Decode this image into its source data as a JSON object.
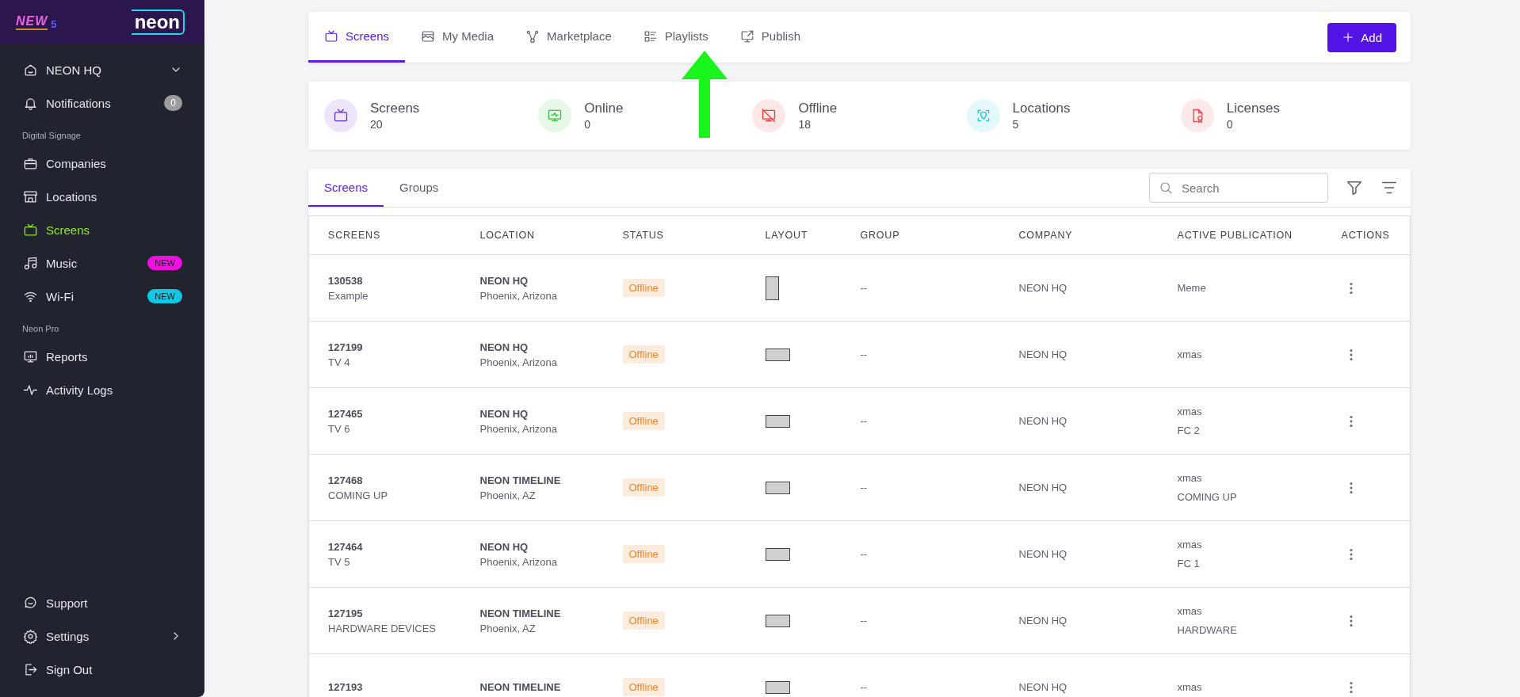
{
  "sidebar": {
    "banner": {
      "text": "NEW",
      "number": "5"
    },
    "logo": "neon",
    "account": {
      "label": "NEON HQ"
    },
    "notifications": {
      "label": "Notifications",
      "count": "0"
    },
    "sections": [
      {
        "title": "Digital Signage",
        "items": [
          {
            "label": "Companies",
            "selected": false
          },
          {
            "label": "Locations",
            "selected": false
          },
          {
            "label": "Screens",
            "selected": true
          },
          {
            "label": "Music",
            "selected": false,
            "badge": {
              "text": "NEW",
              "color": "#f20fe2"
            }
          },
          {
            "label": "Wi-Fi",
            "selected": false,
            "badge": {
              "text": "NEW",
              "color": "#10c8e6"
            }
          }
        ]
      },
      {
        "title": "Neon Pro",
        "items": [
          {
            "label": "Reports",
            "selected": false
          },
          {
            "label": "Activity Logs",
            "selected": false
          }
        ]
      }
    ],
    "footer": [
      {
        "label": "Support",
        "kind": "link"
      },
      {
        "label": "Settings",
        "kind": "submenu"
      },
      {
        "label": "Sign Out",
        "kind": "link"
      }
    ]
  },
  "top_tabs": [
    {
      "label": "Screens",
      "selected": true
    },
    {
      "label": "My Media",
      "selected": false
    },
    {
      "label": "Marketplace",
      "selected": false
    },
    {
      "label": "Playlists",
      "selected": false
    },
    {
      "label": "Publish",
      "selected": false
    }
  ],
  "add_button": "Add",
  "stats": [
    {
      "label": "Screens",
      "value": "20",
      "color": "#6b2fe0"
    },
    {
      "label": "Online",
      "value": "0",
      "color": "#33c13f"
    },
    {
      "label": "Offline",
      "value": "18",
      "color": "#ee3a3a"
    },
    {
      "label": "Locations",
      "value": "5",
      "color": "#1ec5db"
    },
    {
      "label": "Licenses",
      "value": "0",
      "color": "#e6494a"
    }
  ],
  "list_tabs": [
    {
      "label": "Screens",
      "selected": true
    },
    {
      "label": "Groups",
      "selected": false
    }
  ],
  "search": {
    "placeholder": "Search"
  },
  "table": {
    "columns": [
      "SCREENS",
      "LOCATION",
      "STATUS",
      "LAYOUT",
      "GROUP",
      "COMPANY",
      "ACTIVE PUBLICATION",
      "ACTIONS"
    ],
    "rows": [
      {
        "id": "130538",
        "name": "Example",
        "location": "NEON HQ",
        "city": "Phoenix, Arizona",
        "status": "Offline",
        "layout_portrait": true,
        "group": "--",
        "company": "NEON HQ",
        "publication": [
          "Meme"
        ]
      },
      {
        "id": "127199",
        "name": "TV 4",
        "location": "NEON HQ",
        "city": "Phoenix, Arizona",
        "status": "Offline",
        "layout_portrait": false,
        "group": "--",
        "company": "NEON HQ",
        "publication": [
          "xmas"
        ]
      },
      {
        "id": "127465",
        "name": "TV 6",
        "location": "NEON HQ",
        "city": "Phoenix, Arizona",
        "status": "Offline",
        "layout_portrait": false,
        "group": "--",
        "company": "NEON HQ",
        "publication": [
          "xmas",
          "FC 2"
        ]
      },
      {
        "id": "127468",
        "name": "COMING UP",
        "location": "NEON TIMELINE",
        "city": "Phoenix, AZ",
        "status": "Offline",
        "layout_portrait": false,
        "group": "--",
        "company": "NEON HQ",
        "publication": [
          "xmas",
          "COMING UP"
        ]
      },
      {
        "id": "127464",
        "name": "TV 5",
        "location": "NEON HQ",
        "city": "Phoenix, Arizona",
        "status": "Offline",
        "layout_portrait": false,
        "group": "--",
        "company": "NEON HQ",
        "publication": [
          "xmas",
          "FC 1"
        ]
      },
      {
        "id": "127195",
        "name": "HARDWARE DEVICES",
        "location": "NEON TIMELINE",
        "city": "Phoenix, AZ",
        "status": "Offline",
        "layout_portrait": false,
        "group": "--",
        "company": "NEON HQ",
        "publication": [
          "xmas",
          "HARDWARE"
        ]
      },
      {
        "id": "127193",
        "location": "NEON TIMELINE",
        "status": "Offline",
        "layout_portrait": false,
        "group": "--",
        "company": "NEON HQ",
        "publication": [
          "xmas"
        ]
      }
    ]
  }
}
